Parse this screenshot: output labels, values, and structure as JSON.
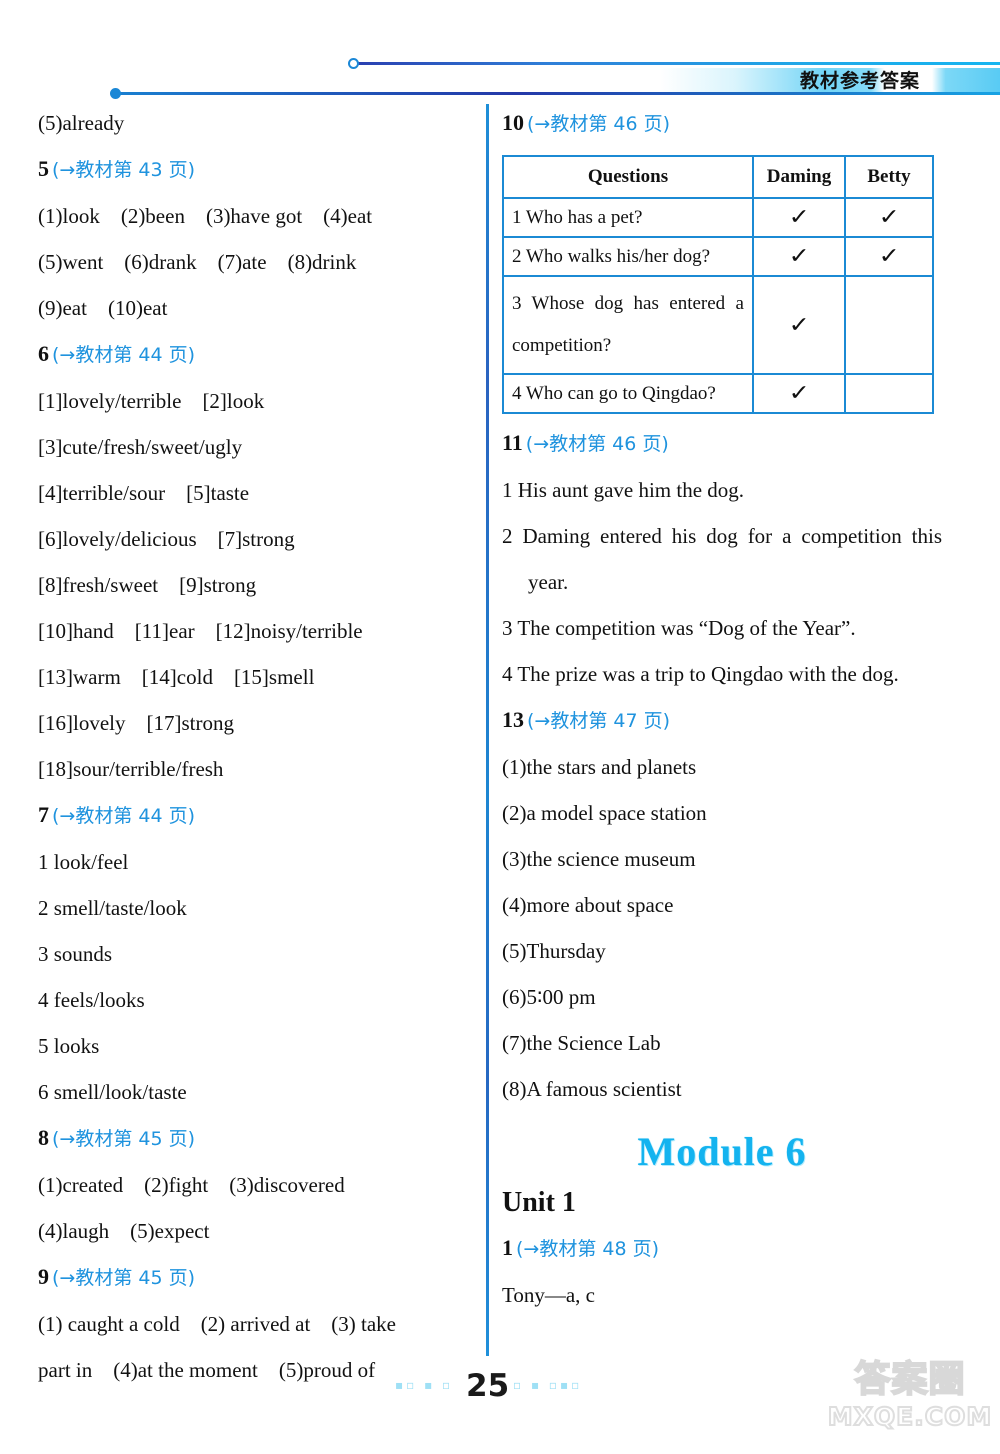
{
  "header": {
    "title": "教材参考答案"
  },
  "footer": {
    "page_number": "25",
    "deco_left": "▪▫ ▪ ▫",
    "deco_right": "▫ ▪ ▫▪▫"
  },
  "watermark": {
    "cn": "答案圈",
    "en": "MXQE.COM"
  },
  "left_column": {
    "carryover": "(5)already",
    "ex5": {
      "num": "5",
      "ref": "(→教材第 43 页)",
      "lines": [
        "(1)look　(2)been　(3)have got　(4)eat",
        "(5)went　(6)drank　(7)ate　(8)drink",
        "(9)eat　(10)eat"
      ]
    },
    "ex6": {
      "num": "6",
      "ref": "(→教材第 44 页)",
      "lines": [
        "[1]lovely/terrible　[2]look",
        "[3]cute/fresh/sweet/ugly",
        "[4]terrible/sour　[5]taste",
        "[6]lovely/delicious　[7]strong",
        "[8]fresh/sweet　[9]strong",
        "[10]hand　[11]ear　[12]noisy/terrible",
        "[13]warm　[14]cold　[15]smell",
        "[16]lovely　[17]strong",
        "[18]sour/terrible/fresh"
      ]
    },
    "ex7": {
      "num": "7",
      "ref": "(→教材第 44 页)",
      "lines": [
        "1 look/feel",
        "2 smell/taste/look",
        "3 sounds",
        "4 feels/looks",
        "5 looks",
        "6 smell/look/taste"
      ]
    },
    "ex8": {
      "num": "8",
      "ref": "(→教材第 45 页)",
      "lines": [
        "(1)created　(2)fight　(3)discovered",
        "(4)laugh　(5)expect"
      ]
    },
    "ex9": {
      "num": "9",
      "ref": "(→教材第 45 页)",
      "line1": "(1) caught a cold　(2) arrived at　(3) take",
      "line2": "part in　(4)at the moment　(5)proud of"
    }
  },
  "right_column": {
    "ex10": {
      "num": "10",
      "ref": "(→教材第 46 页)",
      "table": {
        "headers": [
          "Questions",
          "Daming",
          "Betty"
        ],
        "rows": [
          {
            "question": "1 Who has a pet?",
            "daming": "✓",
            "betty": "✓"
          },
          {
            "question": "2 Who walks his/her dog?",
            "daming": "✓",
            "betty": "✓"
          },
          {
            "question": "3 Whose dog has entered a competition?",
            "daming": "✓",
            "betty": ""
          },
          {
            "question": "4 Who can go to Qingdao?",
            "daming": "✓",
            "betty": ""
          }
        ]
      }
    },
    "ex11": {
      "num": "11",
      "ref": "(→教材第 46 页)",
      "items": [
        "1 His aunt gave him the dog.",
        "2 Daming entered his dog for a competition this year.",
        "3 The competition was “Dog of the Year”.",
        "4 The prize was a trip to Qingdao with the dog."
      ]
    },
    "ex13": {
      "num": "13",
      "ref": "(→教材第 47 页)",
      "lines": [
        "(1)the stars and planets",
        "(2)a model space station",
        "(3)the science museum",
        "(4)more about space",
        "(5)Thursday",
        "(6)5∶00 pm",
        "(7)the Science Lab",
        "(8)A famous scientist"
      ]
    },
    "module_title": "Module 6",
    "unit_title": "Unit 1",
    "ex1": {
      "num": "1",
      "ref": "(→教材第 48 页)",
      "lines": [
        "Tony—a, c"
      ]
    }
  },
  "colors": {
    "accent_blue": "#1f93de",
    "module_cyan": "#14b3ef",
    "table_border": "#1b8ad4",
    "text": "#111111"
  }
}
